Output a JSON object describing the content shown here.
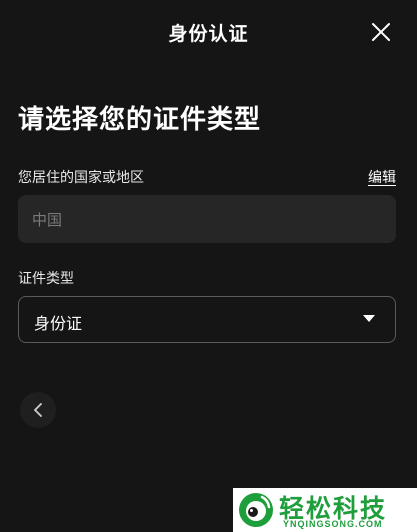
{
  "header": {
    "title": "身份认证",
    "close_icon": "close-icon"
  },
  "main": {
    "heading": "请选择您的证件类型"
  },
  "country": {
    "label": "您居住的国家或地区",
    "edit_label": "编辑",
    "value": "中国"
  },
  "document_type": {
    "label": "证件类型",
    "selected": "身份证",
    "caret_icon": "caret-down-icon"
  },
  "navigation": {
    "back_icon": "chevron-left-icon"
  },
  "watermark": {
    "text": "轻松科技",
    "url": "YNQINGSONG.COM"
  },
  "colors": {
    "background": "#151515",
    "input_background": "#262626",
    "border": "#5a5a5a",
    "watermark_green": "#1f9e3c"
  }
}
